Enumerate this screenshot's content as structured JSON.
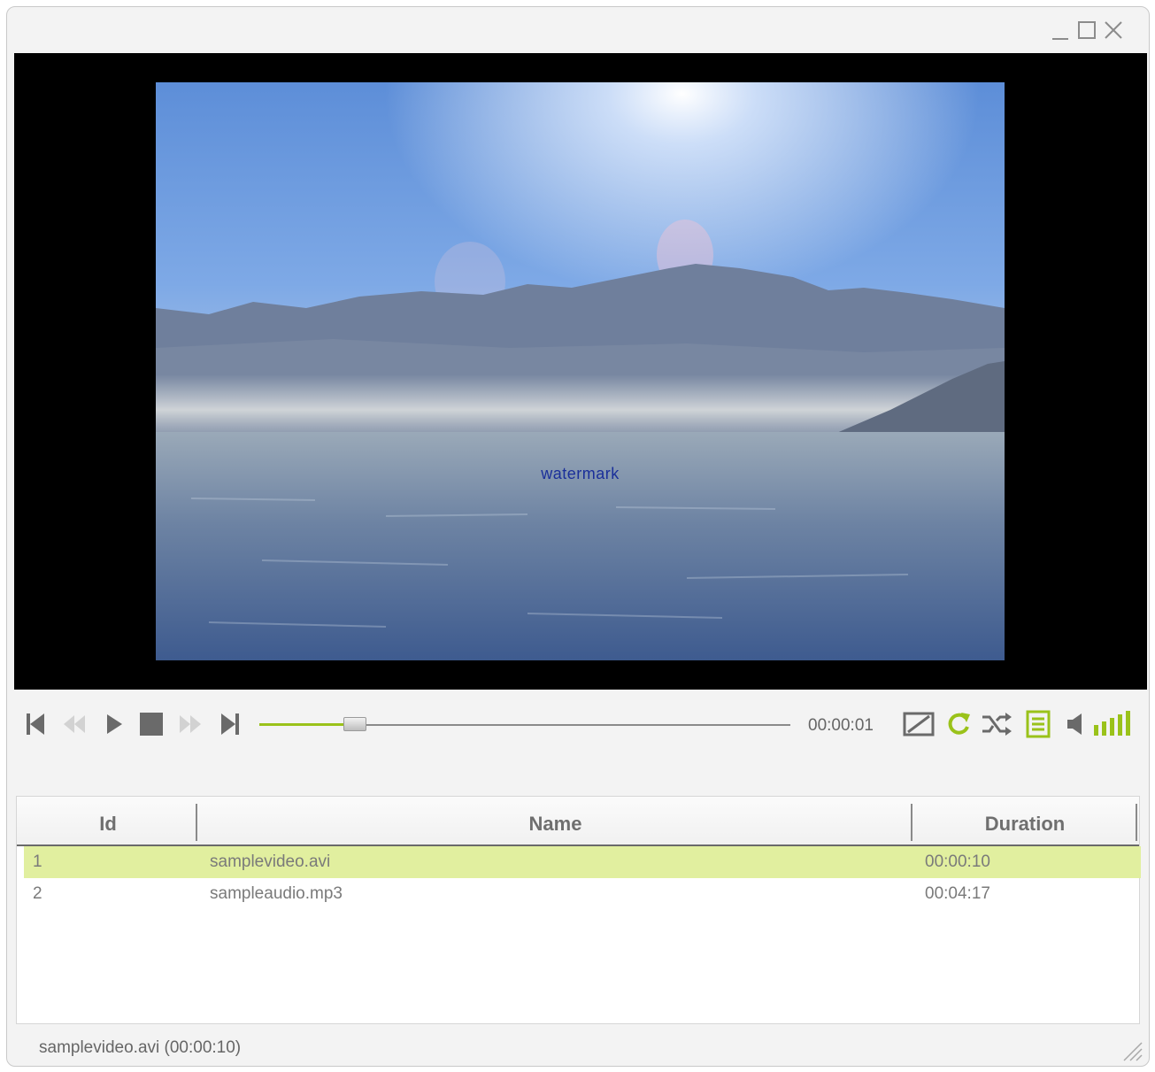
{
  "window": {
    "controls": [
      {
        "name": "minimize-button",
        "icon": "minimize-icon"
      },
      {
        "name": "maximize-button",
        "icon": "maximize-icon"
      },
      {
        "name": "close-button",
        "icon": "close-icon"
      }
    ]
  },
  "video": {
    "watermark": "watermark"
  },
  "controls": {
    "buttons": [
      "previous-track-icon",
      "rewind-icon",
      "play-icon",
      "stop-icon",
      "fast-forward-icon",
      "next-track-icon",
      "fullscreen-icon",
      "repeat-icon",
      "shuffle-icon",
      "playlist-icon",
      "speaker-icon",
      "volume-level-icon"
    ],
    "time": "00:00:01",
    "seek_fraction": 0.18,
    "accent_color": "#9ac21a"
  },
  "playlist": {
    "headers": {
      "id": "Id",
      "name": "Name",
      "duration": "Duration"
    },
    "rows": [
      {
        "id": "1",
        "name": "samplevideo.avi",
        "duration": "00:00:10",
        "selected": true
      },
      {
        "id": "2",
        "name": "sampleaudio.mp3",
        "duration": "00:04:17",
        "selected": false
      }
    ],
    "selected_color": "#e1ef9f"
  },
  "status": {
    "text": "samplevideo.avi (00:00:10)"
  }
}
